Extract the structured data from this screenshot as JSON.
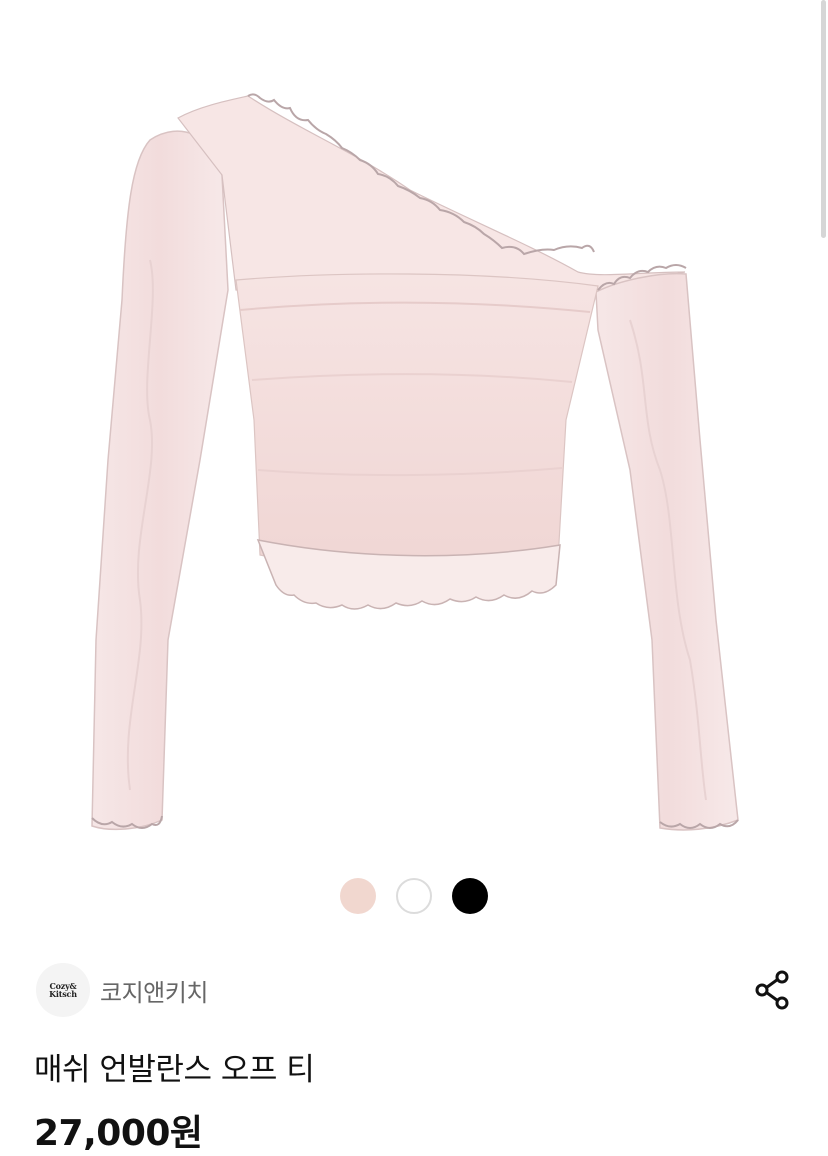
{
  "product": {
    "image_alt": "매쉬 언발란스 오프 티",
    "title": "매쉬 언발란스 오프 티",
    "price": "27,000원"
  },
  "swatches": [
    {
      "name": "pink",
      "color": "#f1d7cf",
      "selected": true
    },
    {
      "name": "white",
      "color": "#ffffff",
      "selected": false
    },
    {
      "name": "black",
      "color": "#000000",
      "selected": false
    }
  ],
  "seller": {
    "name": "코지앤키치",
    "logo_line1": "Cozy&",
    "logo_line2": "Kitsch"
  },
  "icons": {
    "share": "share-icon"
  },
  "colors": {
    "garment": "#f3dede",
    "garment_shadow": "#ebcdcb",
    "edge": "#b9a6a8"
  }
}
